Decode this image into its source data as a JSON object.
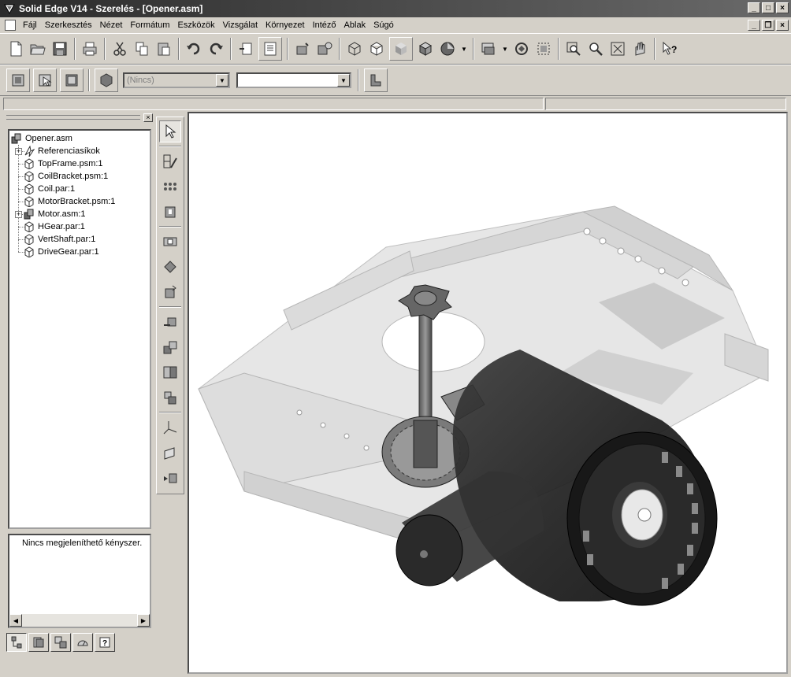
{
  "window": {
    "title": "Solid Edge V14 - Szerelés - [Opener.asm]",
    "buttons": [
      "_",
      "□",
      "×"
    ],
    "inner_buttons": [
      "_",
      "❐",
      "×"
    ]
  },
  "menu": {
    "items": [
      {
        "label": "Fájl"
      },
      {
        "label": "Szerkesztés"
      },
      {
        "label": "Nézet"
      },
      {
        "label": "Formátum"
      },
      {
        "label": "Eszközök"
      },
      {
        "label": "Vizsgálat"
      },
      {
        "label": "Környezet"
      },
      {
        "label": "Intéző"
      },
      {
        "label": "Ablak"
      },
      {
        "label": "Súgó"
      }
    ]
  },
  "toolbar2": {
    "style_combo_value": "(Nincs)",
    "second_combo_value": ""
  },
  "pathfinder": {
    "items": [
      {
        "label": "Opener.asm",
        "icon": "assembly-icon",
        "level": 0,
        "expander": ""
      },
      {
        "label": "Referenciasíkok",
        "icon": "reference-planes-icon",
        "level": 1,
        "expander": "+"
      },
      {
        "label": "TopFrame.psm:1",
        "icon": "part-icon",
        "level": 1,
        "expander": ""
      },
      {
        "label": "CoilBracket.psm:1",
        "icon": "part-icon",
        "level": 1,
        "expander": ""
      },
      {
        "label": "Coil.par:1",
        "icon": "part-icon",
        "level": 1,
        "expander": ""
      },
      {
        "label": "MotorBracket.psm:1",
        "icon": "part-icon",
        "level": 1,
        "expander": ""
      },
      {
        "label": "Motor.asm:1",
        "icon": "assembly-icon",
        "level": 1,
        "expander": "+"
      },
      {
        "label": "HGear.par:1",
        "icon": "part-icon",
        "level": 1,
        "expander": ""
      },
      {
        "label": "VertShaft.par:1",
        "icon": "part-icon",
        "level": 1,
        "expander": ""
      },
      {
        "label": "DriveGear.par:1",
        "icon": "part-icon",
        "level": 1,
        "expander": ""
      }
    ],
    "constraint_message": "Nincs megjeleníthető kényszer."
  }
}
